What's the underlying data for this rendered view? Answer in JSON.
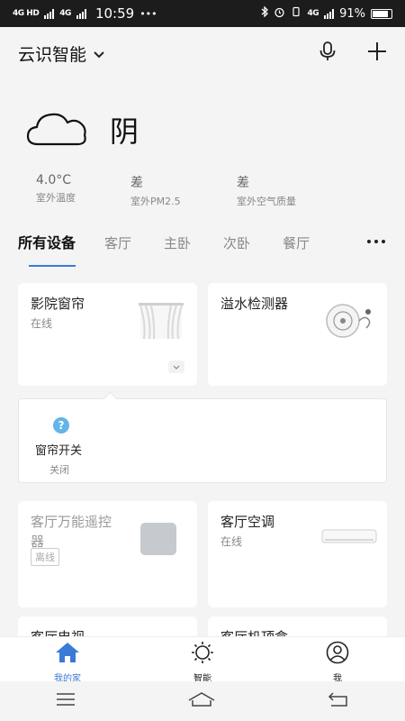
{
  "status_bar": {
    "signal1": "4G HD",
    "signal2": "4G",
    "time": "10:59",
    "dots": "•••",
    "signal3": "4G",
    "battery": "91%"
  },
  "header": {
    "home_name": "云识智能"
  },
  "weather": {
    "condition": "阴",
    "stats": [
      {
        "value": "4.0°C",
        "label": "室外温度"
      },
      {
        "value": "差",
        "label": "室外PM2.5"
      },
      {
        "value": "差",
        "label": "室外空气质量"
      }
    ]
  },
  "tabs": [
    "所有设备",
    "客厅",
    "主卧",
    "次卧",
    "餐厅"
  ],
  "devices": [
    {
      "name": "影院窗帘",
      "status": "在线"
    },
    {
      "name": "溢水检测器",
      "status": ""
    },
    {
      "name": "客厅万能遥控器",
      "status": "离线"
    },
    {
      "name": "客厅空调",
      "status": "在线"
    },
    {
      "name": "客厅电视",
      "status": ""
    },
    {
      "name": "客厅机顶盒",
      "status": ""
    }
  ],
  "subpanel": {
    "help": "?",
    "name": "窗帘开关",
    "status": "关闭"
  },
  "bottom_nav": [
    {
      "label": "我的家"
    },
    {
      "label": "智能"
    },
    {
      "label": "我"
    }
  ],
  "colors": {
    "accent": "#3a7bd5",
    "help": "#62b5ea"
  }
}
